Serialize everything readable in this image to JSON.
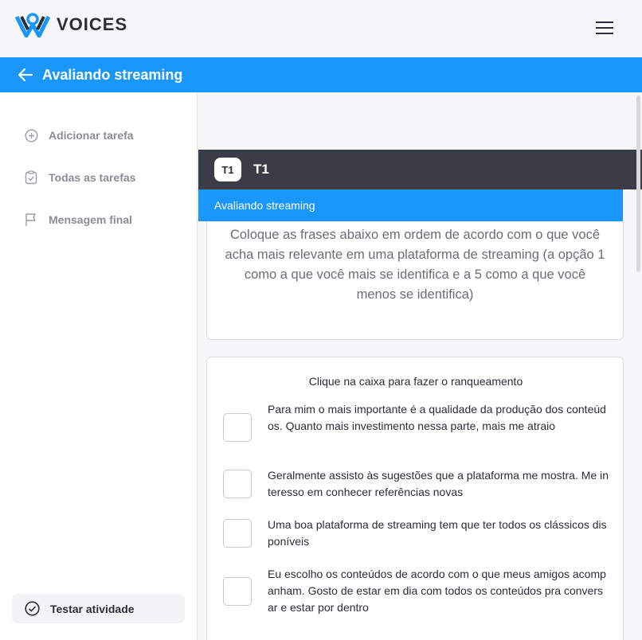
{
  "app": {
    "name": "VOICES"
  },
  "header": {
    "title": "Avaliando streaming"
  },
  "sidebar": {
    "items": [
      {
        "label": "Adicionar tarefa",
        "icon": "plus-circle-icon"
      },
      {
        "label": "Todas as tarefas",
        "icon": "clipboard-check-icon"
      },
      {
        "label": "Mensagem final",
        "icon": "flag-icon"
      }
    ],
    "test_button": "Testar atividade"
  },
  "task": {
    "badge": "T1",
    "title": "T1",
    "subtitle": "Avaliando streaming",
    "instructions": "Coloque as frases abaixo em ordem de acordo com o que você acha mais relevante em uma plataforma de streaming (a opção 1 como a que você mais se identifica e a 5 como a que você menos se identifica)"
  },
  "ranking": {
    "title": "Clique na caixa para fazer o ranqueamento",
    "items": [
      "Para mim o mais importante é a qualidade da produção dos conteúdos. Quanto mais investimento nessa parte, mais me atraio",
      "Geralmente assisto às sugestões que a plataforma me mostra. Me interesso em conhecer referências novas",
      "Uma boa plataforma de streaming tem que ter todos os clássicos disponíveis",
      "Eu escolho os conteúdos de acordo com o que meus amigos acompanham. Gosto de estar em dia com todos os conteúdos pra conversar e estar por dentro"
    ]
  },
  "colors": {
    "accent": "#1a97fb",
    "header_dark": "#3a3d47"
  }
}
